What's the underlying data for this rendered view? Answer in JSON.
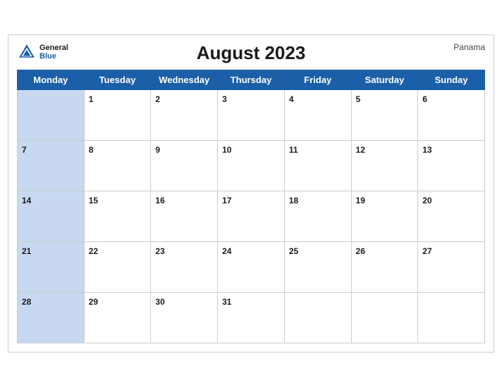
{
  "header": {
    "logo_general": "General",
    "logo_blue": "Blue",
    "title": "August 2023",
    "country": "Panama"
  },
  "weekdays": [
    "Monday",
    "Tuesday",
    "Wednesday",
    "Thursday",
    "Friday",
    "Saturday",
    "Sunday"
  ],
  "weeks": [
    [
      null,
      "1",
      "2",
      "3",
      "4",
      "5",
      "6"
    ],
    [
      "7",
      "8",
      "9",
      "10",
      "11",
      "12",
      "13"
    ],
    [
      "14",
      "15",
      "16",
      "17",
      "18",
      "19",
      "20"
    ],
    [
      "21",
      "22",
      "23",
      "24",
      "25",
      "26",
      "27"
    ],
    [
      "28",
      "29",
      "30",
      "31",
      null,
      null,
      null
    ]
  ]
}
